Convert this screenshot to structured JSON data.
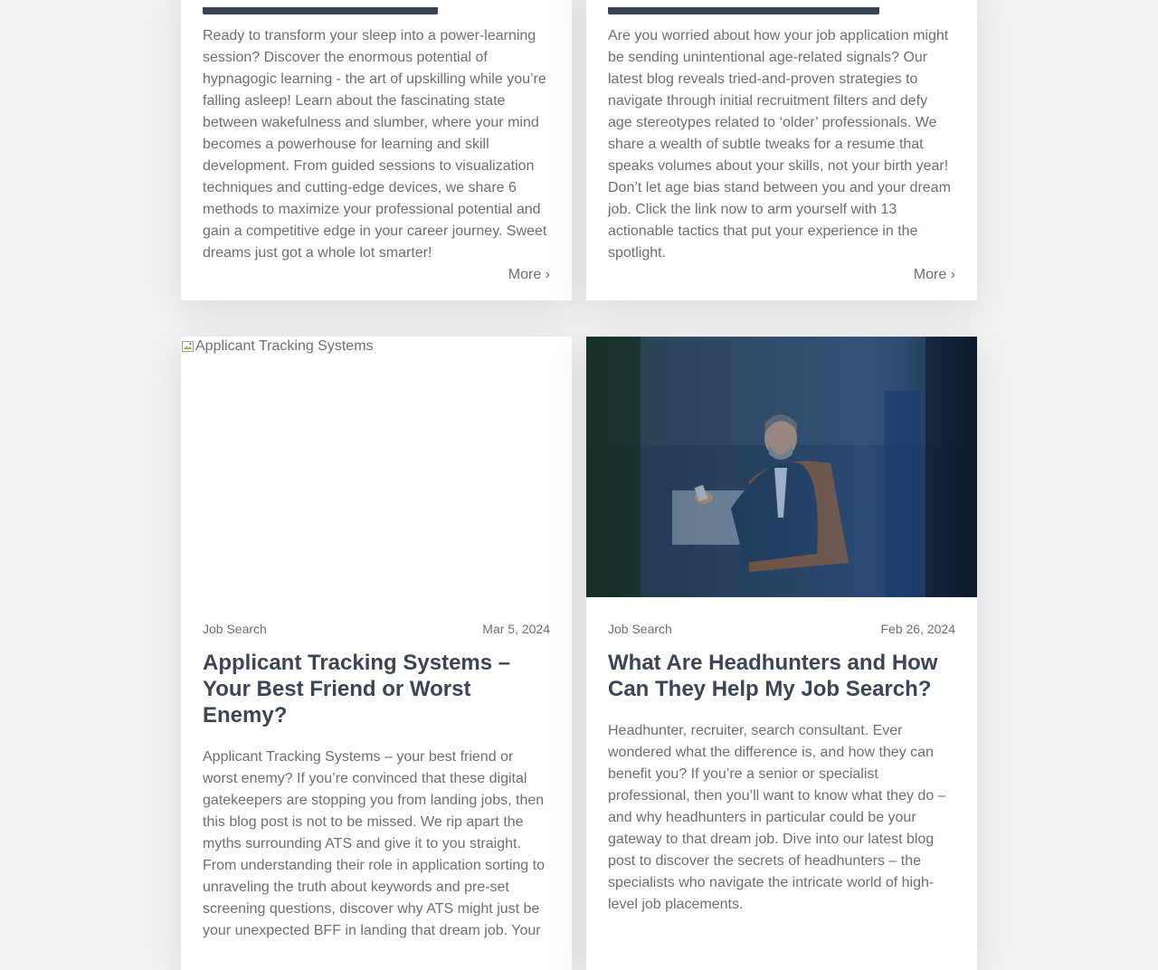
{
  "cards": [
    {
      "excerpt": "Ready to transform your sleep into a power-learning session? Discover the enormous potential of hypnagogic learning - the art of upskilling while you’re falling asleep! Learn about the fascinating state between wakefulness and slumber, where your mind becomes a powerhouse for learning and skill development. From guided sessions to visualization techniques and cutting-edge devices, we share 6 methods to maximize your professional potential and gain a competitive edge in your career journey. Sweet dreams just got a whole lot smarter!",
      "more_label": "More ›"
    },
    {
      "excerpt": "Are you worried about how your job application might be sending unintentional age-related signals? Our latest blog reveals tried-and-proven strategies to navigate through initial recruitment filters and defy age stereotypes related to ‘older’ professionals. We share a wealth of subtle tweaks for a resume that speaks volumes about your skills, not your birth year! Don’t let age bias stand between you and your dream job. Click the link now to arm yourself with 13 actionable tactics that put your experience in the spotlight.",
      "more_label": "More ›"
    },
    {
      "image_alt": "Applicant Tracking Systems",
      "category": "Job Search",
      "date": "Mar 5, 2024",
      "title": "Applicant Tracking Systems – Your Best Friend or Worst Enemy?",
      "excerpt": "Applicant Tracking Systems – your best friend or worst enemy? If you’re convinced that these digital gatekeepers are stopping you from landing jobs, then this blog post is not to be missed. We rip apart the myths surrounding ATS and give it to you straight. From understanding their role in application sorting to unraveling the truth about keywords and pre-set screening questions, discover why ATS might just be your unexpected BFF in landing that dream job. Your"
    },
    {
      "category": "Job Search",
      "date": "Feb 26, 2024",
      "title": "What Are Headhunters and How Can They Help My Job Search?",
      "excerpt": "Headhunter, recruiter, search consultant. Ever wondered what the difference is, and how they can benefit you? If you’re a senior or specialist professional, then you’ll want to know what they do – and why headhunters in particular could be your gateway to that dream job. Dive into our latest blog post to discover the secrets of headhunters – the specialists who navigate the intricate world of high-level job placements."
    }
  ]
}
